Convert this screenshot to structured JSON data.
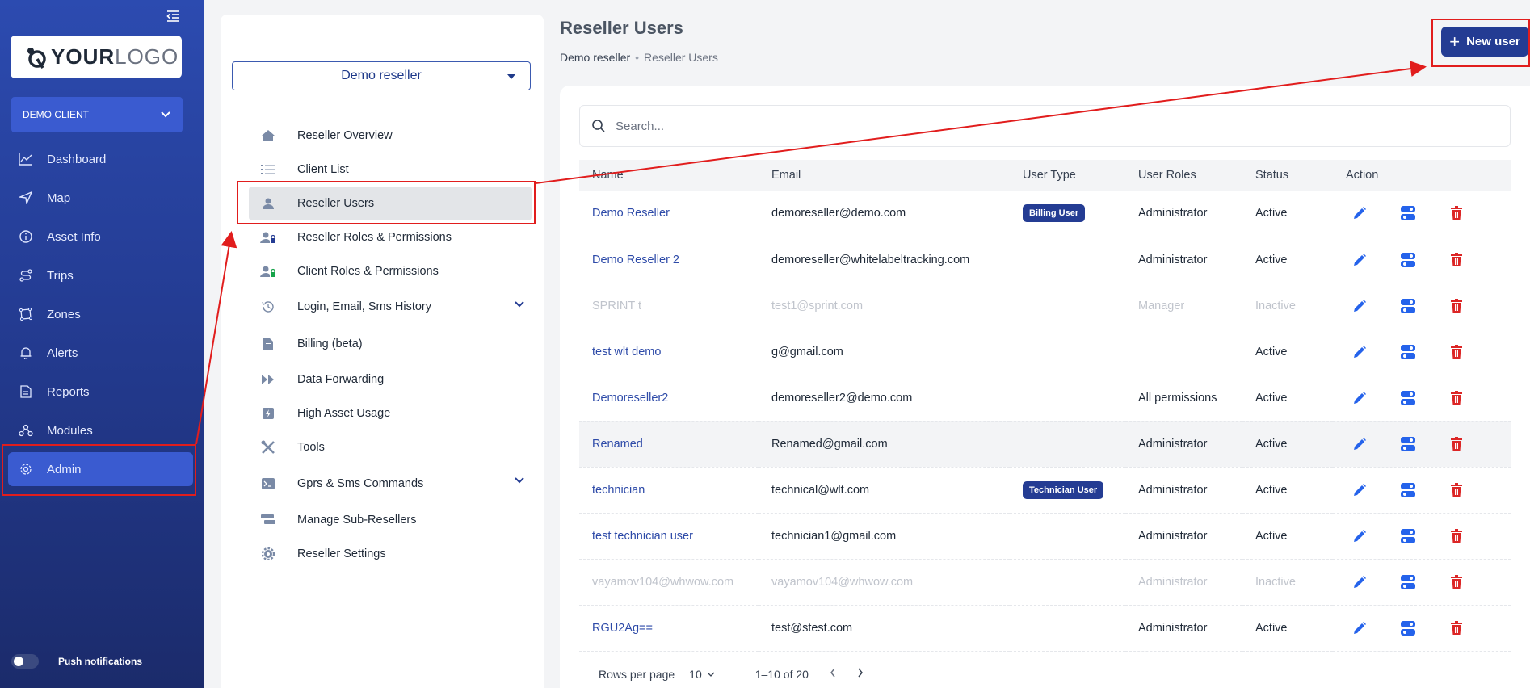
{
  "sidebar": {
    "logo_bold": "YOUR",
    "logo_thin": "LOGO",
    "client": "DEMO CLIENT",
    "items": [
      {
        "label": "Dashboard",
        "icon": "chart-line-icon"
      },
      {
        "label": "Map",
        "icon": "navigation-icon"
      },
      {
        "label": "Asset Info",
        "icon": "info-icon"
      },
      {
        "label": "Trips",
        "icon": "route-icon"
      },
      {
        "label": "Zones",
        "icon": "zones-icon"
      },
      {
        "label": "Alerts",
        "icon": "bell-icon"
      },
      {
        "label": "Reports",
        "icon": "document-icon"
      },
      {
        "label": "Modules",
        "icon": "modules-icon"
      },
      {
        "label": "Admin",
        "icon": "gear-icon",
        "active": true
      }
    ],
    "push_label": "Push notifications"
  },
  "panel": {
    "reseller": "Demo reseller",
    "menu": [
      {
        "label": "Reseller Overview",
        "icon": "home-icon"
      },
      {
        "label": "Client List",
        "icon": "list-icon"
      },
      {
        "label": "Reseller Users",
        "icon": "user-icon",
        "active": true
      },
      {
        "label": "Reseller Roles & Permissions",
        "icon": "user-lock-icon"
      },
      {
        "label": "Client Roles & Permissions",
        "icon": "user-lock-green-icon"
      },
      {
        "label": "Login, Email, Sms History",
        "icon": "history-icon",
        "expandable": true
      },
      {
        "label": "Billing (beta)",
        "icon": "invoice-icon"
      },
      {
        "label": "Data Forwarding",
        "icon": "forward-icon"
      },
      {
        "label": "High Asset Usage",
        "icon": "lightning-icon"
      },
      {
        "label": "Tools",
        "icon": "tools-icon"
      },
      {
        "label": "Gprs & Sms Commands",
        "icon": "terminal-icon",
        "expandable": true
      },
      {
        "label": "Manage Sub-Resellers",
        "icon": "hierarchy-icon"
      },
      {
        "label": "Reseller Settings",
        "icon": "cog-icon"
      }
    ]
  },
  "main": {
    "title": "Reseller Users",
    "breadcrumb": [
      "Demo reseller",
      "Reseller Users"
    ],
    "new_user": "New user",
    "search_placeholder": "Search...",
    "columns": [
      "Name",
      "Email",
      "User Type",
      "User Roles",
      "Status",
      "Action"
    ],
    "rows": [
      {
        "name": "Demo Reseller",
        "email": "demoreseller@demo.com",
        "type": "Billing User",
        "roles": "Administrator",
        "status": "Active"
      },
      {
        "name": "Demo Reseller 2",
        "email": "demoreseller@whitelabeltracking.com",
        "type": "",
        "roles": "Administrator",
        "status": "Active"
      },
      {
        "name": "SPRINT t",
        "email": "test1@sprint.com",
        "type": "",
        "roles": "Manager",
        "status": "Inactive"
      },
      {
        "name": "test wlt demo",
        "email": "g@gmail.com",
        "type": "",
        "roles": "",
        "status": "Active"
      },
      {
        "name": "Demoreseller2",
        "email": "demoreseller2@demo.com",
        "type": "",
        "roles": "All permissions",
        "status": "Active"
      },
      {
        "name": "Renamed",
        "email": "Renamed@gmail.com",
        "type": "",
        "roles": "Administrator",
        "status": "Active",
        "highlight": true
      },
      {
        "name": "technician",
        "email": "technical@wlt.com",
        "type": "Technician User",
        "roles": "Administrator",
        "status": "Active"
      },
      {
        "name": "test technician user",
        "email": "technician1@gmail.com",
        "type": "",
        "roles": "Administrator",
        "status": "Active"
      },
      {
        "name": "vayamov104@whwow.com",
        "email": "vayamov104@whwow.com",
        "type": "",
        "roles": "Administrator",
        "status": "Inactive"
      },
      {
        "name": "RGU2Ag==",
        "email": "test@stest.com",
        "type": "",
        "roles": "Administrator",
        "status": "Active"
      }
    ],
    "pagination": {
      "rows_label": "Rows per page",
      "rows_value": "10",
      "range": "1–10 of 20"
    }
  },
  "colors": {
    "brand": "#243c93",
    "annotation": "#e11d1d",
    "edit": "#2563eb",
    "delete": "#dc2626"
  }
}
